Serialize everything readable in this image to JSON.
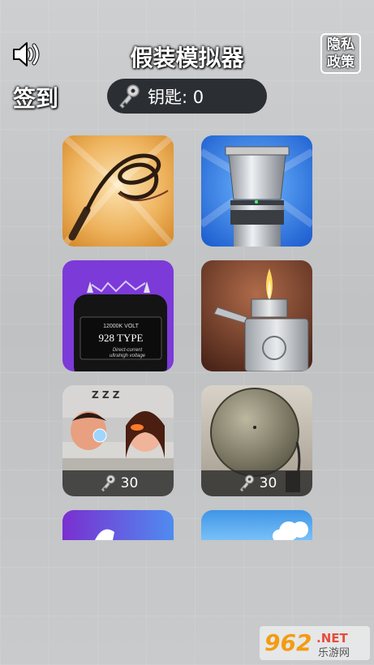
{
  "header": {
    "title": "假装模拟器",
    "privacy_label": "隐私政策",
    "signin_label": "签到",
    "keys_label": "钥匙: 0"
  },
  "icons": {
    "sound": "speaker-icon",
    "key": "key-icon"
  },
  "grid": [
    {
      "name": "whip",
      "locked": false
    },
    {
      "name": "hair-clipper",
      "locked": false
    },
    {
      "name": "stun-gun",
      "locked": false,
      "label_top": "12000K VOLT",
      "label_mid": "928 TYPE",
      "label_bot1": "Direct-current",
      "label_bot2": "ultrahigh voltage"
    },
    {
      "name": "lighter",
      "locked": false
    },
    {
      "name": "snoring-couple",
      "locked": true,
      "cost": "30",
      "zzz": "Z Z Z"
    },
    {
      "name": "bell",
      "locked": true,
      "cost": "30"
    },
    {
      "name": "purple-card",
      "locked": false
    },
    {
      "name": "sky-card",
      "locked": false
    }
  ],
  "watermark": {
    "brand": "962",
    "suffix": ".NET",
    "sub": "乐游网"
  },
  "colors": {
    "accent_orange": "#f39c12",
    "key_bar": "#2b2e32"
  }
}
